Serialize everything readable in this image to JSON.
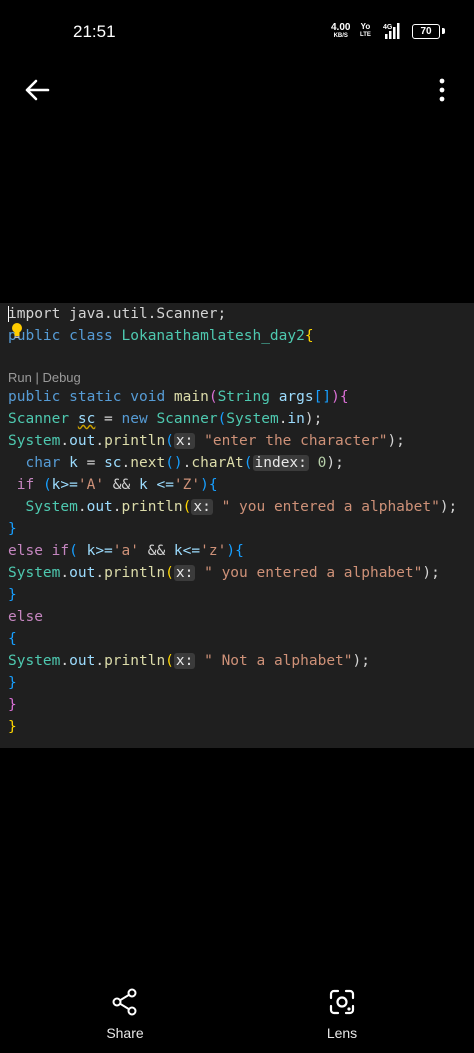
{
  "status_bar": {
    "time": "21:51",
    "net_speed": "4.00",
    "net_unit": "KB/S",
    "volte_top": "Yo",
    "volte_bottom": "LTE",
    "signal_label": "4G",
    "battery": "70"
  },
  "toolbar": {
    "back_icon": "arrow-left-icon",
    "more_icon": "more-vertical-icon"
  },
  "code": {
    "line1": {
      "a": "import java.util.Scanner;"
    },
    "line2": {
      "kw1": "public",
      "kw2": "class",
      "name": "Lokanathamlatesh_day2",
      "brace": "{"
    },
    "lens": "Run | Debug",
    "line3": {
      "kw1": "public",
      "kw2": "static",
      "kw3": "void",
      "fn": "main",
      "p1": "(",
      "ty": "String",
      "arg": "args",
      "arr": "[]",
      "p2": ")",
      "brace": "{"
    },
    "line4": {
      "ty1": "Scanner",
      "var": "sc",
      "eq": " = ",
      "kw": "new",
      "ty2": "Scanner",
      "p1": "(",
      "ty3": "System",
      "dot": ".",
      "in": "in",
      "p2": ");"
    },
    "line5": {
      "ty": "System",
      "out": "out",
      "fn": "println",
      "hint": "x:",
      "str": "\"enter the character\"",
      "end": ");"
    },
    "line6": {
      "kw": "char",
      "var": "k",
      "eq": " = ",
      "sc": "sc",
      "next": "next",
      "paren": "()",
      "charAt": "charAt",
      "hint": "index:",
      "num": "0",
      "end": ");"
    },
    "line7": {
      "kw": "if",
      "cond1": "k>=",
      "ch1": "'A'",
      "and": " && ",
      "cond2": "k <=",
      "ch2": "'Z'",
      "brace": "{"
    },
    "line8": {
      "ty": "System",
      "out": "out",
      "fn": "println",
      "hint": "x:",
      "str": "\" you entered a alphabet\"",
      "end": ");"
    },
    "line9": "}",
    "line10": {
      "kw1": "else",
      "kw2": "if",
      "cond1": "k>=",
      "ch1": "'a'",
      "and": " && ",
      "cond2": "k<=",
      "ch2": "'z'",
      "brace": "{"
    },
    "line11": {
      "ty": "System",
      "out": "out",
      "fn": "println",
      "hint": "x:",
      "str": "\" you entered a alphabet\"",
      "end": ");"
    },
    "line12": "}",
    "line13": "else",
    "line14": "{",
    "line15": {
      "ty": "System",
      "out": "out",
      "fn": "println",
      "hint": "x:",
      "str": "\" Not a alphabet\"",
      "end": ");"
    },
    "line16": "}",
    "line17": "}",
    "line18": "}"
  },
  "bottom": {
    "share_label": "Share",
    "lens_label": "Lens"
  }
}
